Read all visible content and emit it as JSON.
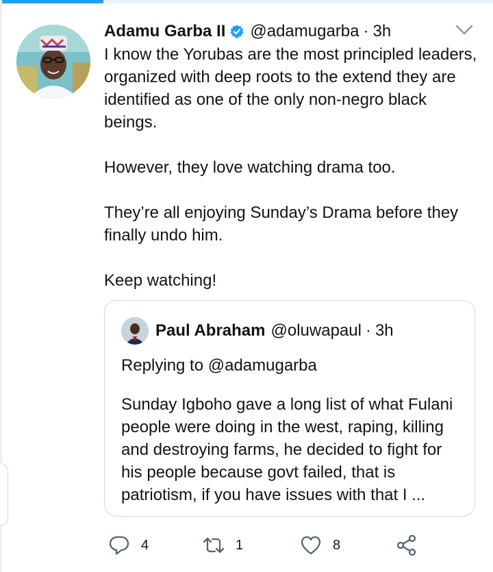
{
  "progress": {
    "fraction": 0.21,
    "color": "#1da1f2"
  },
  "tweet": {
    "author_name": "Adamu Garba II",
    "handle": "@adamugarba",
    "dot": "·",
    "time": "3h",
    "verified_icon": "verified-badge-icon",
    "menu_icon": "chevron-down-icon",
    "text": "I know the Yorubas are the most principled leaders, organized with deep roots to the extend they are identified as one of the only non-negro black beings.\n\nHowever, they love watching drama too.\n\nThey’re all enjoying Sunday’s Drama before they finally undo him.\n\nKeep watching!"
  },
  "quoted_tweet": {
    "author_name": "Paul Abraham",
    "handle": "@oluwapaul",
    "dot": "·",
    "time": "3h",
    "replying_to": "Replying to @adamugarba",
    "text": "Sunday Igboho gave a long list of what Fulani people were doing in the west, raping, killing and destroying farms, he decided to fight for his people because govt failed, that is patriotism, if you have issues with that I ..."
  },
  "actions": {
    "reply": {
      "icon": "reply-icon",
      "count": "4"
    },
    "retweet": {
      "icon": "retweet-icon",
      "count": "1"
    },
    "like": {
      "icon": "heart-icon",
      "count": "8"
    },
    "share": {
      "icon": "share-icon"
    }
  },
  "colors": {
    "accent": "#1da1f2",
    "text": "#0f1419",
    "icon": "#536471",
    "border": "#cfd9de"
  }
}
